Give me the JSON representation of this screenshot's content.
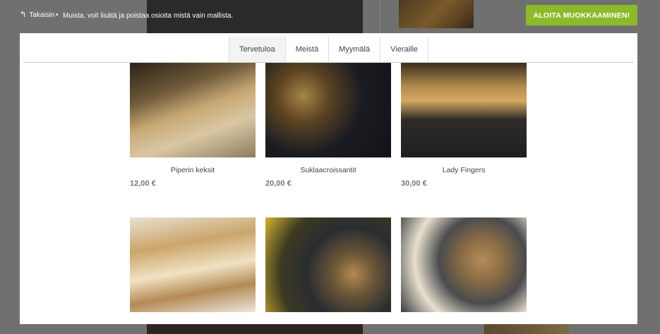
{
  "topbar": {
    "back_label": "Takaisin",
    "hint": "Muista, voit lisätä ja poistaa osioita mistä vain mallista.",
    "start_button": "ALOITA MUOKKAAMINEN!"
  },
  "nav": {
    "tabs": [
      {
        "label": "Tervetuloa",
        "active": true
      },
      {
        "label": "Meistä",
        "active": false
      },
      {
        "label": "Myymälä",
        "active": false
      },
      {
        "label": "Vieraille",
        "active": false
      }
    ]
  },
  "products": [
    {
      "name": "Piperin keksit",
      "price": "12,00 €"
    },
    {
      "name": "Suklaacroissantit",
      "price": "20,00 €"
    },
    {
      "name": "Lady Fingers",
      "price": "30,00 €"
    },
    {
      "name": "",
      "price": ""
    },
    {
      "name": "",
      "price": ""
    },
    {
      "name": "",
      "price": ""
    }
  ],
  "colors": {
    "accent": "#8cba2a",
    "overlay": "#707070"
  },
  "icons": {
    "back": "back-arrow-icon"
  }
}
